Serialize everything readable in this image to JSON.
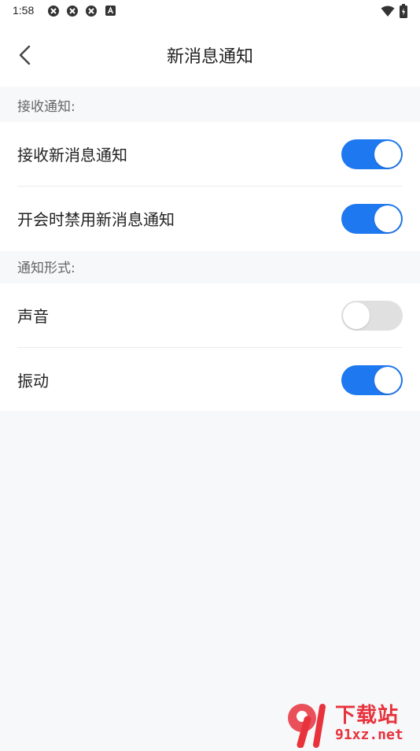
{
  "status_bar": {
    "time": "1:58",
    "left_icons": [
      "app-notification-icon",
      "app-notification-icon",
      "app-notification-icon",
      "a-icon"
    ],
    "right_icons": [
      "wifi-icon",
      "battery-icon"
    ]
  },
  "header": {
    "title": "新消息通知",
    "back_icon": "chevron-left-icon"
  },
  "sections": [
    {
      "label": "接收通知:",
      "items": [
        {
          "label": "接收新消息通知",
          "enabled": true
        },
        {
          "label": "开会时禁用新消息通知",
          "enabled": true
        }
      ]
    },
    {
      "label": "通知形式:",
      "items": [
        {
          "label": "声音",
          "enabled": false
        },
        {
          "label": "振动",
          "enabled": true
        }
      ]
    }
  ],
  "colors": {
    "accent": "#1e78f0",
    "toggle_off": "#e0e0e0",
    "background": "#f7f8fa",
    "watermark": "#e8323c"
  },
  "watermark": {
    "text": "下载站",
    "url": "91xz.net"
  }
}
